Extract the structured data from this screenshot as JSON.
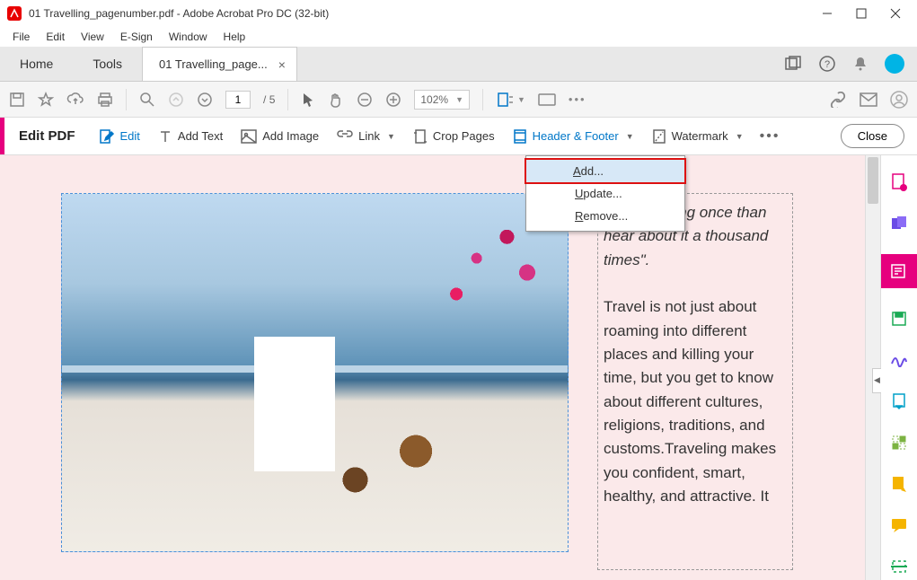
{
  "window": {
    "title": "01 Travelling_pagenumber.pdf - Adobe Acrobat Pro DC (32-bit)"
  },
  "menubar": [
    "File",
    "Edit",
    "View",
    "E-Sign",
    "Window",
    "Help"
  ],
  "tabs": {
    "home": "Home",
    "tools": "Tools",
    "file": "01 Travelling_page..."
  },
  "toolbar": {
    "page_current": "1",
    "page_sep": "/",
    "page_total": "5",
    "zoom": "102%"
  },
  "edit_toolbar": {
    "label": "Edit PDF",
    "edit": "Edit",
    "add_text": "Add Text",
    "add_image": "Add Image",
    "link": "Link",
    "crop_pages": "Crop Pages",
    "header_footer": "Header & Footer",
    "watermark": "Watermark",
    "close": "Close"
  },
  "dropdown": {
    "add": "Add...",
    "update": "Update...",
    "remove": "Remove..."
  },
  "document": {
    "quote_partial": "ee something once than hear about it a thousand times\".",
    "body": "Travel is not just about roaming into different places and killing your time, but you get to know about different cultures, religions, traditions, and customs.Traveling makes you confident, smart, healthy, and attractive. It"
  }
}
